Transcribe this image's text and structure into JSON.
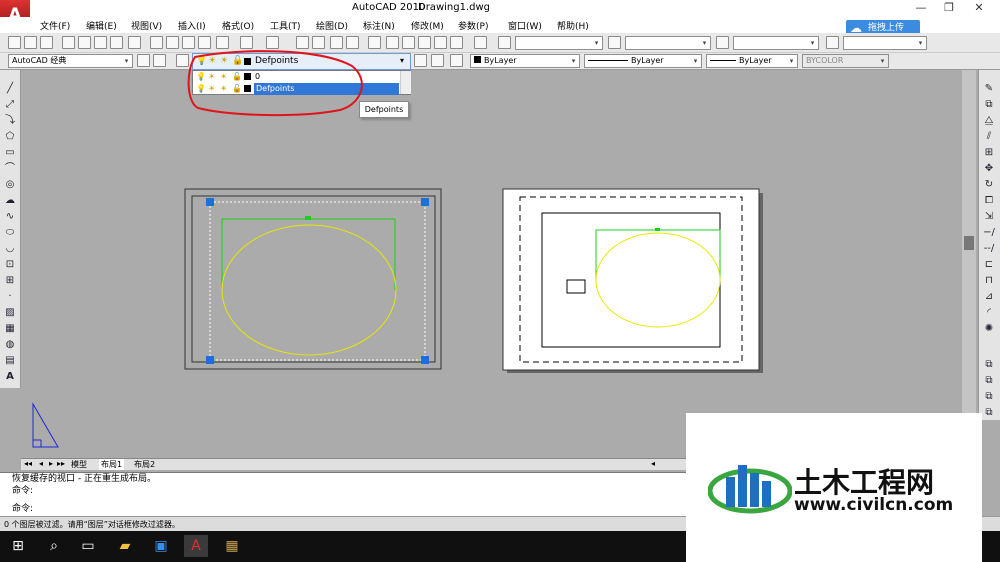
{
  "app": {
    "title": "AutoCAD 2010",
    "document": "Drawing1.dwg",
    "logo_letter": "A"
  },
  "menu": [
    "文件(F)",
    "编辑(E)",
    "视图(V)",
    "插入(I)",
    "格式(O)",
    "工具(T)",
    "绘图(D)",
    "标注(N)",
    "修改(M)",
    "参数(P)",
    "窗口(W)",
    "帮助(H)"
  ],
  "cloud_upload": {
    "label": "拖拽上传"
  },
  "toolbar2": {
    "workspace": "AutoCAD 经典",
    "layer_current": "Defpoints",
    "color": "ByLayer",
    "linetype": "ByLayer",
    "lineweight": "ByLayer",
    "plotstyle": "BYCOLOR"
  },
  "layer_list": [
    {
      "name": "0",
      "selected": false
    },
    {
      "name": "Defpoints",
      "selected": true
    }
  ],
  "tooltip": "Defpoints",
  "tabs": [
    "模型",
    "布局1",
    "布局2"
  ],
  "command_history": [
    "恢复缓存的视口 - 正在重生成布局。",
    "命令:"
  ],
  "command_prompt": "命令:",
  "status_text": "0 个图层被过滤。请用“图层”对话框修改过滤器。",
  "watermark": {
    "name": "土木工程网",
    "url": "www.civilcn.com"
  },
  "colors": {
    "highlight": "#3078d8",
    "annotation": "#e0141b",
    "viewport_green": "#19d219",
    "ellipse_yellow": "#e8e800",
    "grip_blue": "#1c6ed8"
  },
  "icons": [
    "windows-start-icon",
    "search-icon",
    "task-view-icon",
    "file-explorer-icon",
    "store-icon",
    "autocad-icon",
    "image-viewer-icon"
  ]
}
